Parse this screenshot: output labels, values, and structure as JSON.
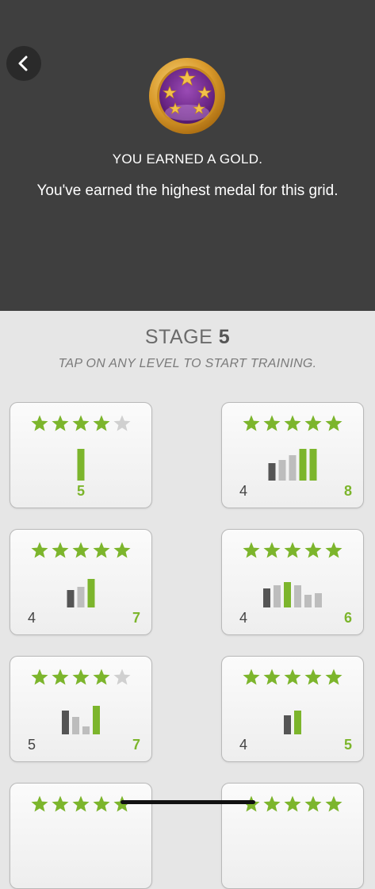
{
  "header": {
    "title": "YOU EARNED A GOLD.",
    "subtitle": "You've earned the highest medal for this grid.",
    "medal": "gold-five-star-medal",
    "back_icon": "chevron-left-icon"
  },
  "stage": {
    "label": "STAGE",
    "number": "5",
    "instruction": "TAP ON ANY LEVEL TO START TRAINING."
  },
  "colors": {
    "accent_green": "#7cb52c",
    "bar_dark": "#555555",
    "bar_light": "#bdbdbd",
    "star_empty": "#d0d0d0",
    "header_bg": "#3f3f3f"
  },
  "levels": [
    {
      "stars": 4,
      "left": "",
      "right": "5",
      "bars": [
        "g"
      ]
    },
    {
      "stars": 5,
      "left": "4",
      "right": "8",
      "bars": [
        "d",
        "l",
        "l",
        "g",
        "g"
      ]
    },
    {
      "stars": 5,
      "left": "4",
      "right": "7",
      "bars": [
        "d",
        "l",
        "g"
      ]
    },
    {
      "stars": 5,
      "left": "4",
      "right": "6",
      "bars": [
        "d",
        "l",
        "g",
        "l",
        "l",
        "l"
      ]
    },
    {
      "stars": 4,
      "left": "5",
      "right": "7",
      "bars": [
        "d",
        "l",
        "l",
        "g"
      ]
    },
    {
      "stars": 5,
      "left": "4",
      "right": "5",
      "bars": [
        "d",
        "g"
      ]
    },
    {
      "stars": 5,
      "left": "",
      "right": "",
      "bars": []
    },
    {
      "stars": 5,
      "left": "",
      "right": "",
      "bars": []
    }
  ]
}
